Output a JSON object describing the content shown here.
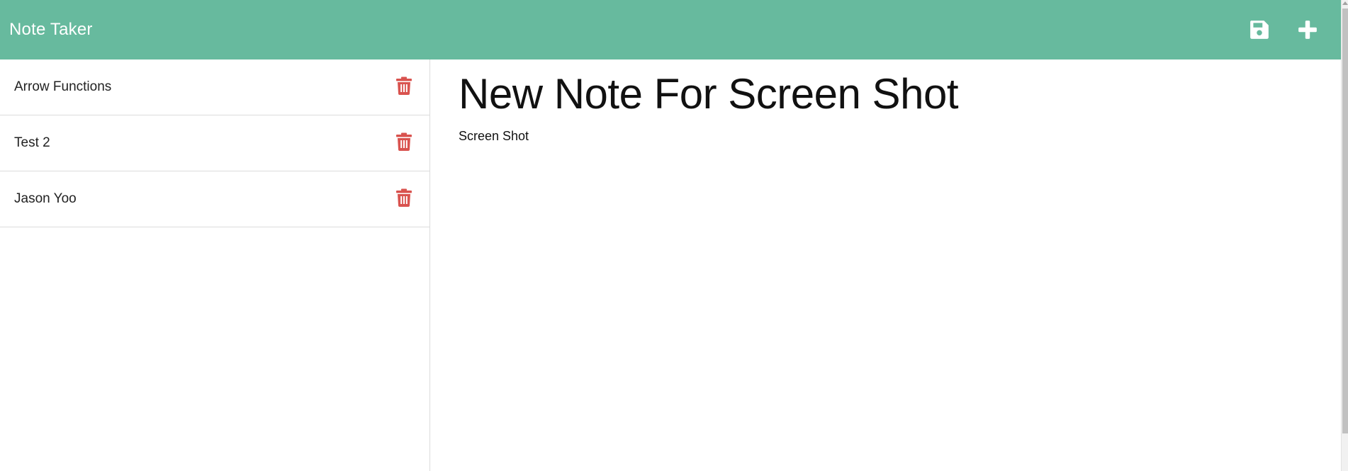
{
  "app": {
    "title": "Note Taker"
  },
  "colors": {
    "navbar": "#67ba9e",
    "delete_icon": "#d9534f",
    "nav_icon": "#ffffff"
  },
  "toolbar": {
    "save_icon": "save-icon",
    "new_icon": "plus-icon"
  },
  "notes": [
    {
      "title": "Arrow Functions",
      "delete_icon": "trash-icon"
    },
    {
      "title": "Test 2",
      "delete_icon": "trash-icon"
    },
    {
      "title": "Jason Yoo",
      "delete_icon": "trash-icon"
    }
  ],
  "active_note": {
    "title": "New Note For Screen Shot",
    "text": "Screen Shot"
  }
}
